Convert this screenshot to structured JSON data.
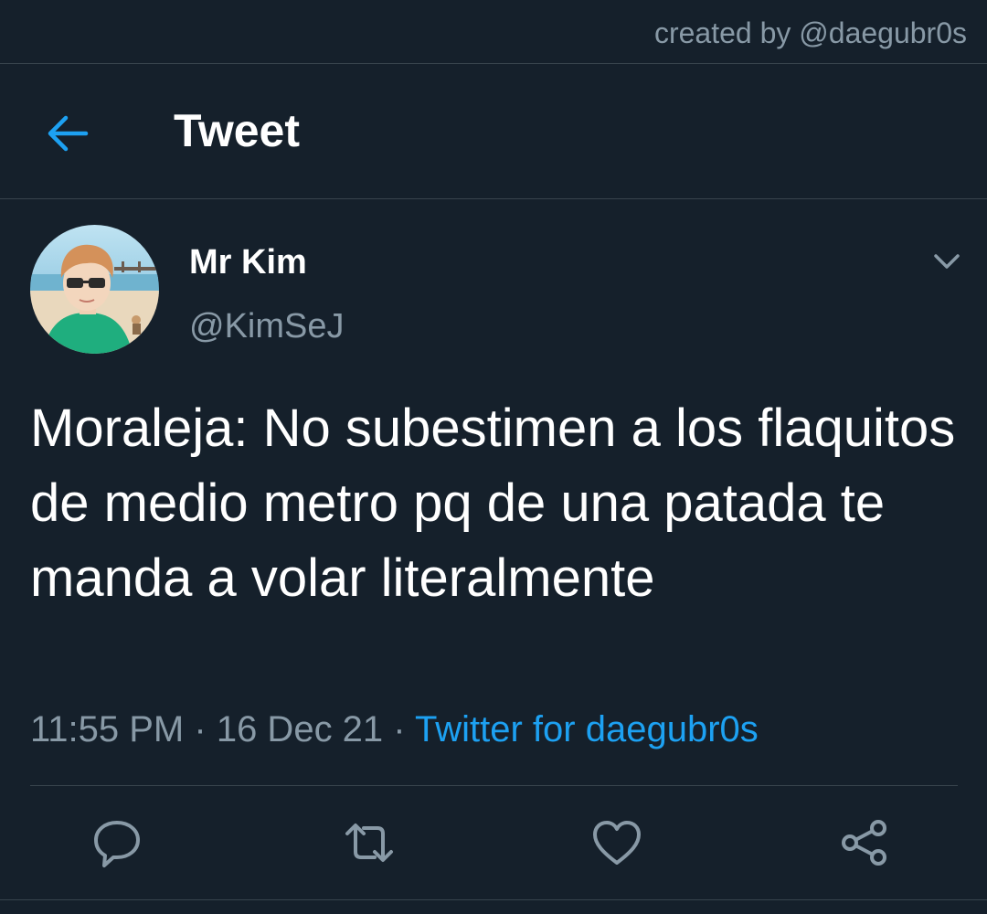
{
  "credit": "created by @daegubr0s",
  "header": {
    "title": "Tweet",
    "back_icon": "arrow-left-icon"
  },
  "tweet": {
    "display_name": "Mr Kim",
    "handle": "@KimSeJ",
    "text": "Moraleja: No subestimen a los flaquitos de medio metro pq de una patada te manda a volar literalmente",
    "time": "11:55 PM",
    "separator": "·",
    "date": "16 Dec 21",
    "source": "Twitter for daegubr0s"
  },
  "actions": [
    "reply-icon",
    "retweet-icon",
    "like-icon",
    "share-icon"
  ],
  "colors": {
    "background": "#15202b",
    "accent": "#1da1f2",
    "muted": "#8899a6",
    "border": "#38444d"
  }
}
